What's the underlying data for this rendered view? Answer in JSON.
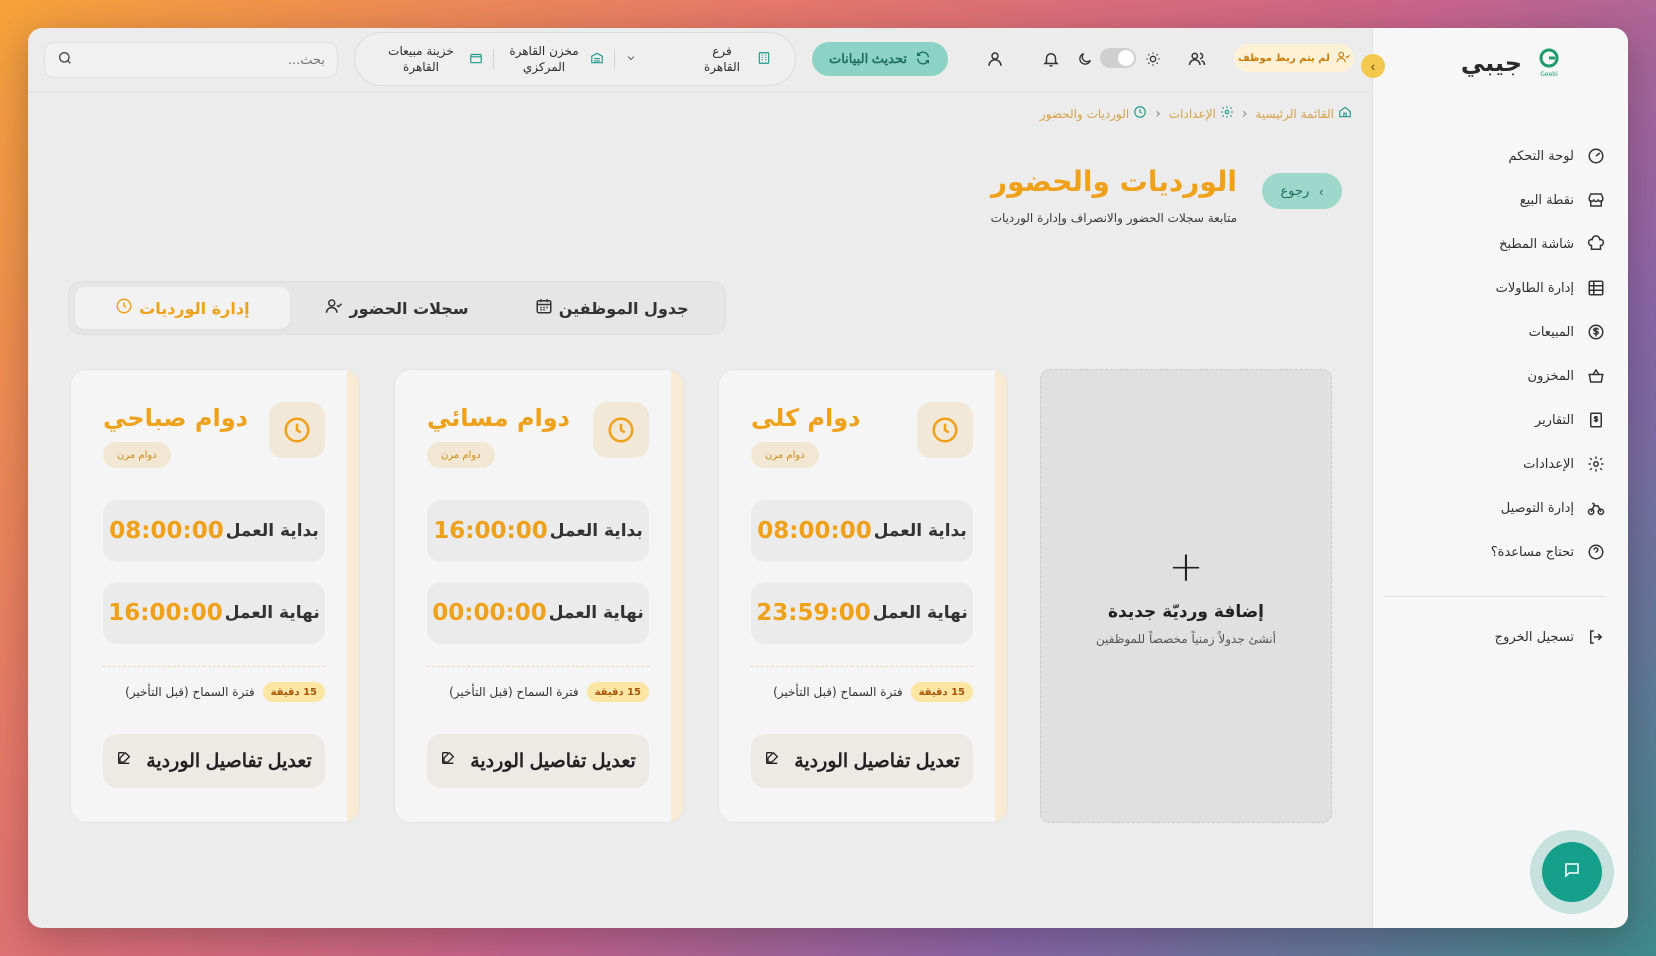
{
  "brand": {
    "name": "جيبي",
    "logo_text": "Geebi"
  },
  "sidebar": {
    "items": [
      {
        "label": "لوحة التحكم",
        "icon": "gauge-icon"
      },
      {
        "label": "نقطة البيع",
        "icon": "store-icon"
      },
      {
        "label": "شاشة المطبخ",
        "icon": "chef-hat-icon"
      },
      {
        "label": "إدارة الطاولات",
        "icon": "table-grid-icon"
      },
      {
        "label": "المبيعات",
        "icon": "dollar-circle-icon"
      },
      {
        "label": "المخزون",
        "icon": "basket-icon"
      },
      {
        "label": "التقارير",
        "icon": "receipt-icon"
      },
      {
        "label": "الإعدادات",
        "icon": "gear-icon"
      },
      {
        "label": "إدارة التوصيل",
        "icon": "bike-icon"
      },
      {
        "label": "تحتاج مساعدة؟",
        "icon": "help-circle-icon"
      }
    ],
    "logout": "تسجيل الخروج"
  },
  "topbar": {
    "search_placeholder": "بحث...",
    "branch": "فرع القاهرة",
    "warehouse": "مخزن القاهرة المركزي",
    "cashbox": "خزينة مبيعات القاهرة",
    "refresh": "تحديث البيانات",
    "employee_badge": "لم يتم ربط موظف"
  },
  "breadcrumb": {
    "home": "القائمة الرئيسية",
    "settings": "الإعدادات",
    "current": "الورديات والحضور"
  },
  "page": {
    "back": "رجوع",
    "title": "الورديات والحضور",
    "subtitle": "متابعة سجلات الحضور والانصراف وإدارة الورديات"
  },
  "tabs": [
    {
      "label": "جدول الموظفين",
      "icon": "calendar-icon"
    },
    {
      "label": "سجلات الحضور",
      "icon": "user-check-icon"
    },
    {
      "label": "إدارة الورديات",
      "icon": "clock-icon",
      "active": true
    }
  ],
  "add_card": {
    "title": "إضافة ورديّة جديدة",
    "subtitle": "أنشئ جدولاً زمنياً مخصصاً للموظفين"
  },
  "shift_labels": {
    "start": "بداية العمل",
    "end": "نهاية العمل",
    "grace": "فترة السماح (قبل التأخير)",
    "edit": "تعديل تفاصيل الوردية"
  },
  "shifts": [
    {
      "name": "دوام كلى",
      "type": "دوام مرن",
      "start": "08:00:00",
      "end": "23:59:00",
      "grace": "15 دقيقة"
    },
    {
      "name": "دوام مسائي",
      "type": "دوام مرن",
      "start": "16:00:00",
      "end": "00:00:00",
      "grace": "15 دقيقة"
    },
    {
      "name": "دوام صباحي",
      "type": "دوام مرن",
      "start": "08:00:00",
      "end": "16:00:00",
      "grace": "15 دقيقة"
    }
  ],
  "colors": {
    "accent": "#f0a11a",
    "teal": "#15a08c"
  }
}
